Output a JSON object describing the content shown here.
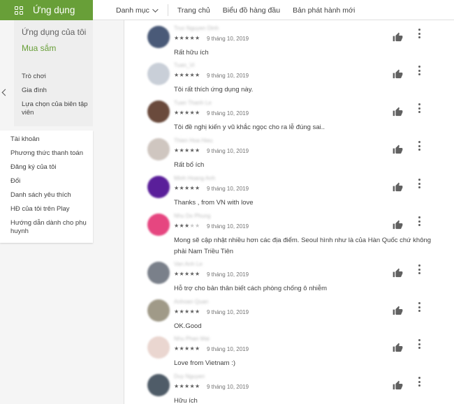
{
  "header": {
    "app_tab_label": "Ứng dụng",
    "nav": [
      "Danh mục",
      "Trang chủ",
      "Biểu đồ hàng đầu",
      "Bản phát hành mới"
    ]
  },
  "submenu": {
    "my_apps": "Ứng dụng của tôi",
    "shopping": "Mua sắm",
    "items": [
      "Trò chơi",
      "Gia đình",
      "Lựa chọn của biên tập viên"
    ]
  },
  "account_menu": {
    "items": [
      "Tài khoản",
      "Phương thức thanh toán",
      "Đăng ký của tôi",
      "Đổi",
      "Danh sách yêu thích",
      "HĐ của tôi trên Play",
      "Hướng dẫn dành cho phụ huynh"
    ]
  },
  "reviews": [
    {
      "name": "Truc Nguyen Dinh",
      "stars": 5,
      "date": "9 tháng 10, 2019",
      "text": "Rất hữu ích",
      "avatar_color": "#4a5a78"
    },
    {
      "name": "Tuan_Vi",
      "stars": 5,
      "date": "9 tháng 10, 2019",
      "text": "Tôi rất thích ứng dụng này.",
      "avatar_color": "#c9cfd8"
    },
    {
      "name": "Tuan Thanh Le",
      "stars": 5,
      "date": "9 tháng 10, 2019",
      "text": "Tôi đề nghị kiến          y vũ khắc ngọc cho ra lễ đúng sai..",
      "avatar_color": "#6a4a3c"
    },
    {
      "name": "Thien Hoa Hieu",
      "stars": 5,
      "date": "9 tháng 10, 2019",
      "text": "Rất bổ ích",
      "avatar_color": "#cfc6c0"
    },
    {
      "name": "Minh Hoang Anh",
      "stars": 5,
      "date": "9 tháng 10, 2019",
      "text": "Thanks , from VN with love",
      "avatar_color": "#5a1f9a"
    },
    {
      "name": "Nhu Do Phung",
      "stars": 3,
      "date": "9 tháng 10, 2019",
      "text": "Mong sẽ cập nhật nhiều hơn các địa điểm. Seoul hình như là của Hàn Quốc chứ không phải Nam Triều Tiên",
      "avatar_color": "#e64680"
    },
    {
      "name": "Van Anh Le",
      "stars": 5,
      "date": "9 tháng 10, 2019",
      "text": "Hỗ trợ cho bản thân biết cách phòng chống ô nhiễm",
      "avatar_color": "#7a808a"
    },
    {
      "name": "Anhoan Quan",
      "stars": 5,
      "date": "9 tháng 10, 2019",
      "text": "OK.Good",
      "avatar_color": "#a09a88"
    },
    {
      "name": "Nhu Phan Mai",
      "stars": 5,
      "date": "9 tháng 10, 2019",
      "text": "Love from Vietnam :)",
      "avatar_color": "#ead6d0"
    },
    {
      "name": "Duy Nguyen",
      "stars": 5,
      "date": "9 tháng 10, 2019",
      "text": "Hữu ích",
      "avatar_color": "#4f5c68"
    }
  ],
  "colors": {
    "accent": "#689f38"
  },
  "icons": {
    "app_tab": "apps-grid-icon",
    "back": "chevron-left-icon",
    "nav_dropdown": "chevron-down-icon",
    "like": "thumb-up-icon",
    "more": "more-vert-icon"
  }
}
